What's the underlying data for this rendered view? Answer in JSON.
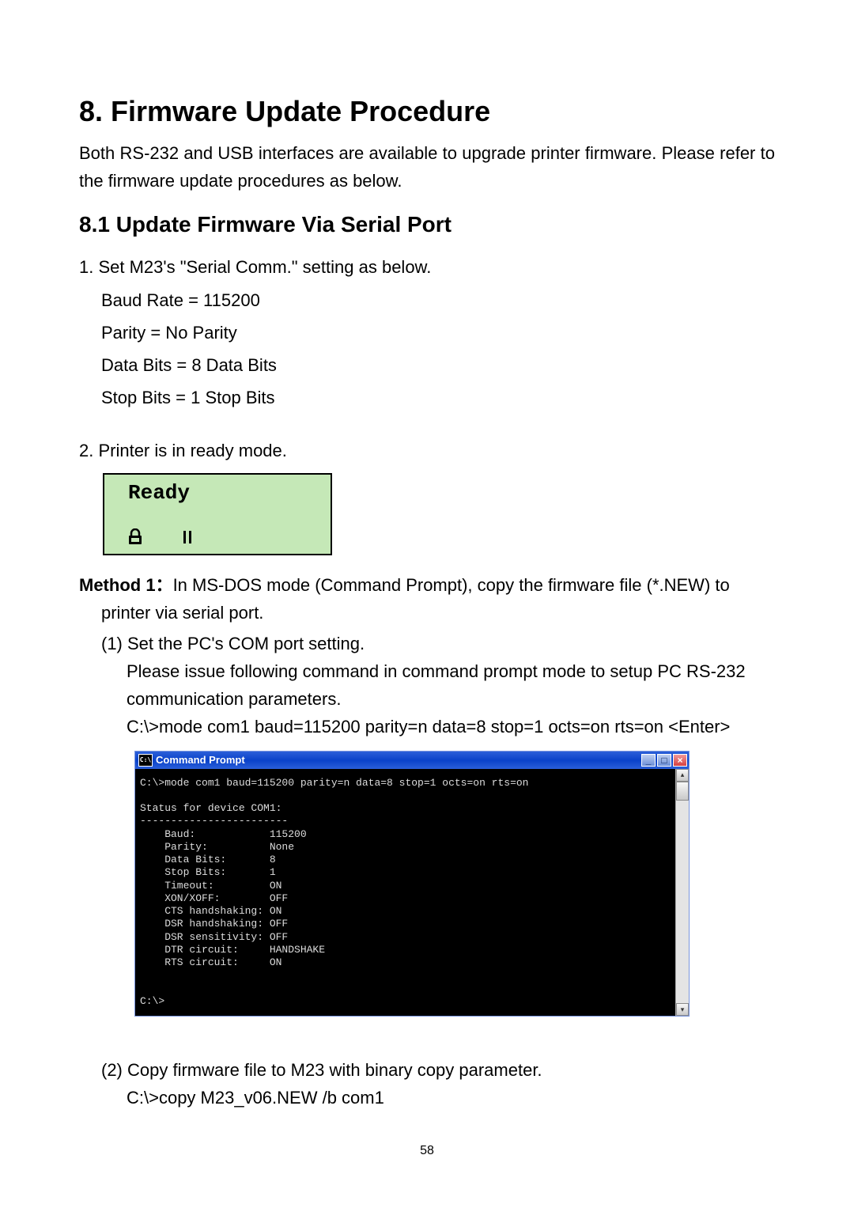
{
  "heading": "8. Firmware Update Procedure",
  "intro": "Both RS-232 and USB interfaces are available to upgrade printer firmware. Please refer to the firmware update procedures as below.",
  "subheading": "8.1 Update Firmware Via Serial Port",
  "step1": {
    "line": "1. Set M23's \"Serial Comm.\" setting as below.",
    "baud": "Baud Rate = 115200",
    "parity": "Parity = No Parity",
    "databits": "Data Bits = 8 Data Bits",
    "stopbits": "Stop Bits = 1 Stop Bits"
  },
  "step2": {
    "line": "2. Printer is in ready mode.",
    "ready_label": "Ready"
  },
  "method1": {
    "label": "Method 1：",
    "text_a": "In MS-DOS mode (Command Prompt), copy the firmware file (*.NEW) to",
    "text_b": "printer via serial port.",
    "sub1_title": "(1) Set the PC's COM port setting.",
    "sub1_desc": "Please issue following command in command prompt mode to setup PC RS-232 communication parameters.",
    "sub1_cmd": "C:\\>mode com1 baud=115200 parity=n data=8 stop=1 octs=on rts=on <Enter>",
    "sub2_title": "(2) Copy firmware file to M23 with binary copy parameter.",
    "sub2_cmd": "C:\\>copy M23_v06.NEW /b com1"
  },
  "cmd_window": {
    "title": "Command Prompt",
    "icon_text": "C:\\",
    "body": "C:\\>mode com1 baud=115200 parity=n data=8 stop=1 octs=on rts=on\n\nStatus for device COM1:\n------------------------\n    Baud:            115200\n    Parity:          None\n    Data Bits:       8\n    Stop Bits:       1\n    Timeout:         ON\n    XON/XOFF:        OFF\n    CTS handshaking: ON\n    DSR handshaking: OFF\n    DSR sensitivity: OFF\n    DTR circuit:     HANDSHAKE\n    RTS circuit:     ON\n\n\nC:\\>"
  },
  "page_number": "58"
}
